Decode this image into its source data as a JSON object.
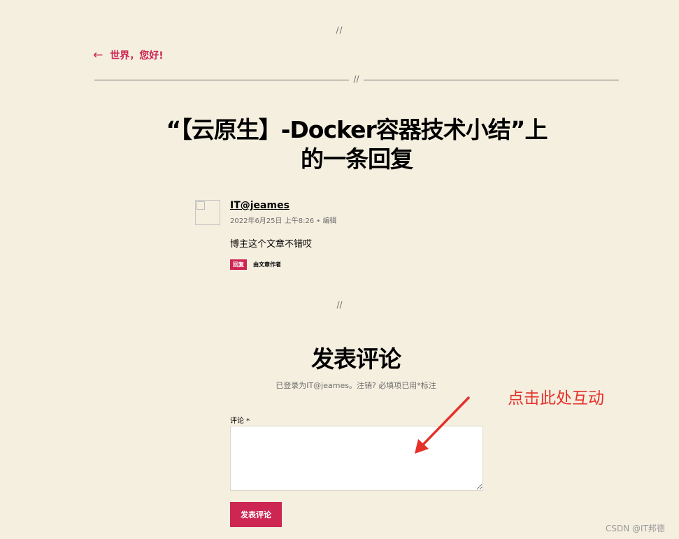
{
  "separators": {
    "top": "//",
    "rule": "//",
    "middle": "//"
  },
  "nav": {
    "back_arrow": "←",
    "back_label": "世界，您好!"
  },
  "post": {
    "title": "“【云原生】-Docker容器技术小结”上的一条回复"
  },
  "comment": {
    "author": "IT@jeames",
    "date": "2022年6月25日 上午8:26",
    "meta_sep": " • ",
    "edit_label": "编辑",
    "text": "博主这个文章不错哎",
    "reply_label": "回复",
    "by_author_label": "由文章作者"
  },
  "form": {
    "title": "发表评论",
    "logged_in_prefix": "已登录为",
    "logged_in_user": "IT@jeames",
    "logged_in_suffix": "。",
    "logout_label": "注销?",
    "required_note": " 必填项已用*标注",
    "comment_label": "评论 *",
    "comment_value": "",
    "submit_label": "发表评论"
  },
  "annotation": {
    "text": "点击此处互动",
    "color": "#e4312a"
  },
  "watermark": "CSDN @IT邦德",
  "colors": {
    "background": "#f5efe0",
    "accent": "#cd2653",
    "muted": "#6d6d6d"
  },
  "icons": {
    "back": "left-arrow-icon",
    "avatar": "broken-image-icon",
    "annotation": "red-arrow-icon"
  }
}
